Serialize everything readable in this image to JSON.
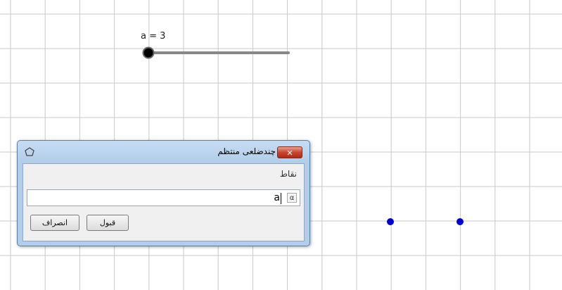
{
  "slider": {
    "label": "a = 3",
    "value": 3
  },
  "dialog": {
    "title": "چندضلعی منتظم",
    "title_icon": "regular-polygon-icon",
    "close_symbol": "✕",
    "points_label": "نقاط",
    "input_value": "a",
    "alpha_symbol": "α",
    "ok_label": "قبول",
    "cancel_label": "انصراف"
  },
  "colors": {
    "grid": "#c8c8c8",
    "point": "#0000cc",
    "slider_track": "#888888",
    "dialog_border": "#5a7ea8"
  }
}
